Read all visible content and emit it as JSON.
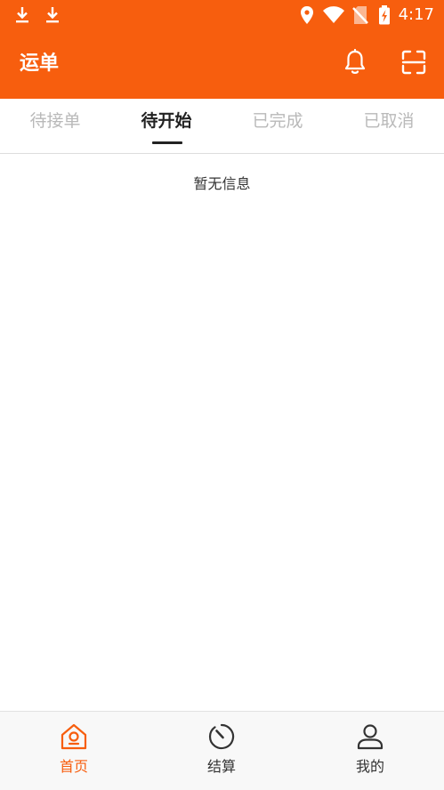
{
  "colors": {
    "accent": "#f75e0e",
    "tab_active": "#222222",
    "tab_inactive": "#b9b9b9",
    "text": "#333333"
  },
  "status_bar": {
    "time": "4:17",
    "icons": [
      "download-icon",
      "download-icon",
      "location-icon",
      "wifi-icon",
      "no-sim-icon",
      "battery-charging-icon"
    ]
  },
  "header": {
    "title": "运单",
    "icons": [
      "bell-icon",
      "scan-icon"
    ]
  },
  "tabs": [
    {
      "label": "待接单",
      "active": false
    },
    {
      "label": "待开始",
      "active": true
    },
    {
      "label": "已完成",
      "active": false
    },
    {
      "label": "已取消",
      "active": false
    }
  ],
  "content": {
    "empty_message": "暂无信息"
  },
  "bottom_nav": [
    {
      "label": "首页",
      "icon": "home-icon",
      "active": true
    },
    {
      "label": "结算",
      "icon": "timer-icon",
      "active": false
    },
    {
      "label": "我的",
      "icon": "user-icon",
      "active": false
    }
  ]
}
